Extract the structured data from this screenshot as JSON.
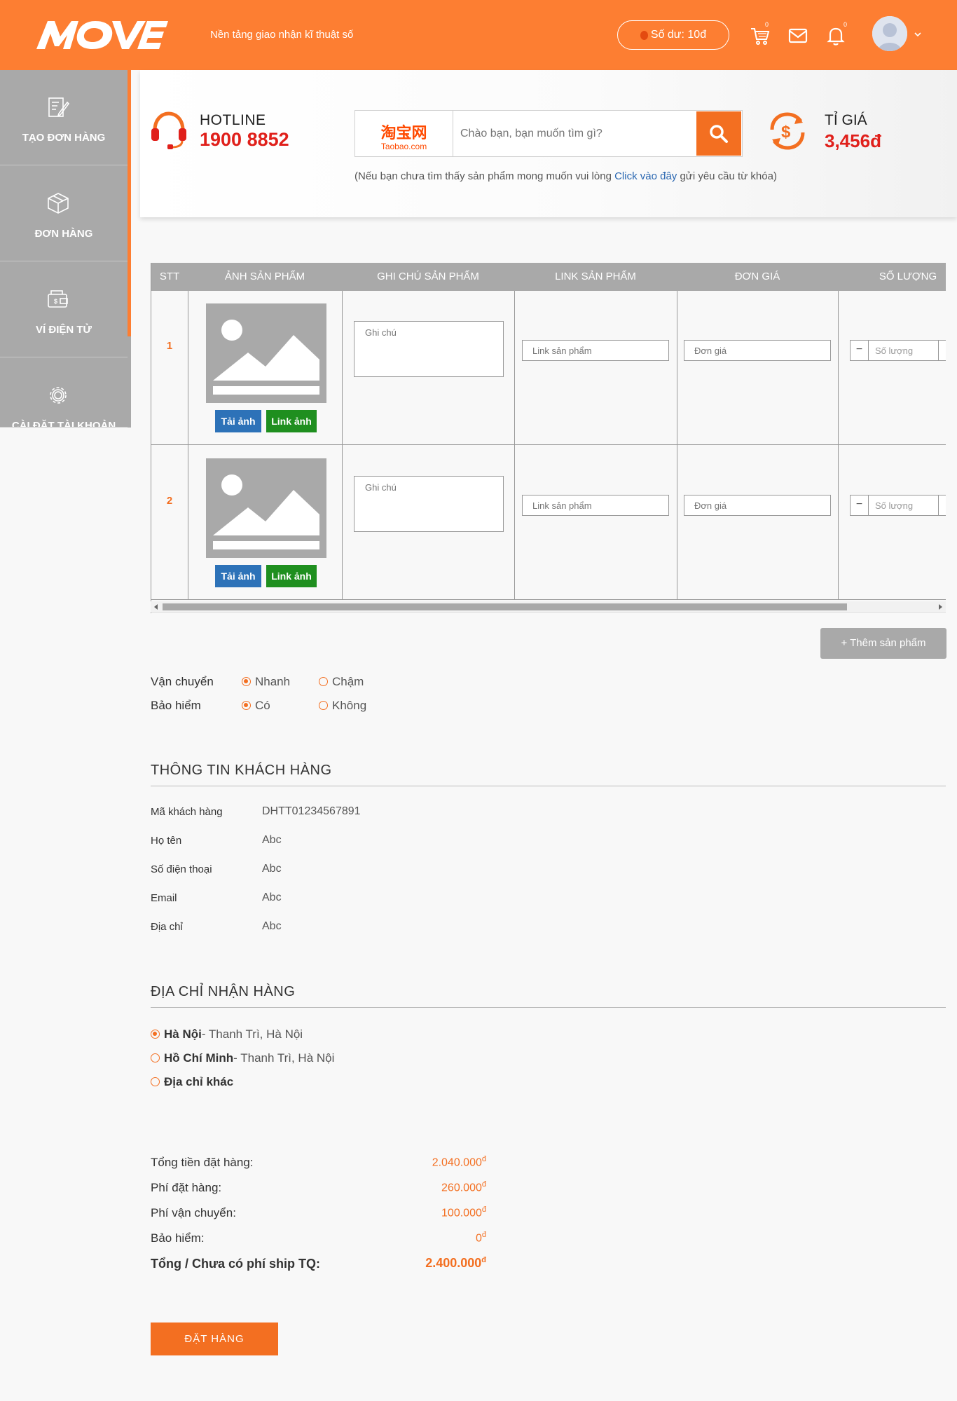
{
  "header": {
    "logo": "MOVE",
    "tagline": "Nền tảng giao nhận kĩ thuật số",
    "balance_label": "Số dư: 10đ",
    "cart_count": "0",
    "notif_count": "0",
    "icons": [
      "cart-icon",
      "mail-icon",
      "bell-icon",
      "avatar",
      "chevron-down-icon"
    ]
  },
  "sidebar": {
    "items": [
      {
        "label": "TẠO ĐƠN HÀNG",
        "icon": "edit-document-icon"
      },
      {
        "label": "ĐƠN HÀNG",
        "icon": "box-icon"
      },
      {
        "label": "VÍ ĐIỆN TỬ",
        "icon": "wallet-icon"
      },
      {
        "label": "CÀI ĐẶT TÀI KHOẢN",
        "icon": "gear-icon"
      }
    ]
  },
  "hotline": {
    "title": "HOTLINE",
    "number": "1900 8852"
  },
  "search": {
    "site_name": "淘宝网",
    "site_domain": "Taobao.com",
    "placeholder": "Chào bạn, bạn muốn tìm gì?",
    "hint_before": "(Nếu bạn chưa tìm thấy sản phẩm mong muốn vui lòng ",
    "hint_link": "Click vào đây",
    "hint_after": " gửi yêu cầu từ khóa)"
  },
  "rate": {
    "title": "TỈ GIÁ",
    "value": "3,456đ"
  },
  "table": {
    "columns": [
      "STT",
      "ẢNH SẢN PHẨM",
      "GHI CHÚ SẢN PHẨM",
      "LINK SẢN PHẨM",
      "ĐƠN GIÁ",
      "SỐ LƯỢNG"
    ],
    "rows": [
      {
        "stt": "1",
        "upload_label": "Tải ảnh",
        "link_label": "Link ảnh",
        "note_placeholder": "Ghi chú",
        "link_placeholder": "Link sản phẩm",
        "price_placeholder": "Đơn giá",
        "qty_placeholder": "Số lượng",
        "qty_minus": "−"
      },
      {
        "stt": "2",
        "upload_label": "Tải ảnh",
        "link_label": "Link ảnh",
        "note_placeholder": "Ghi chú",
        "link_placeholder": "Link sản phẩm",
        "price_placeholder": "Đơn giá",
        "qty_placeholder": "Số lượng",
        "qty_minus": "−"
      }
    ]
  },
  "add_product_label": "+ Thêm sản phẩm",
  "options": {
    "shipping": {
      "label": "Vận chuyển",
      "choices": [
        "Nhanh",
        "Chậm"
      ],
      "selected": "Nhanh"
    },
    "insurance": {
      "label": "Bảo hiểm",
      "choices": [
        "Có",
        "Không"
      ],
      "selected": "Có"
    }
  },
  "customer": {
    "title": "THÔNG TIN KHÁCH HÀNG",
    "fields": [
      {
        "key": "Mã khách hàng",
        "value": "DHTT01234567891"
      },
      {
        "key": "Họ tên",
        "value": "Abc"
      },
      {
        "key": "Số điện thoại",
        "value": "Abc"
      },
      {
        "key": "Email",
        "value": "Abc"
      },
      {
        "key": "Địa chỉ",
        "value": "Abc"
      }
    ]
  },
  "delivery": {
    "title": "ĐỊA CHỈ NHẬN HÀNG",
    "addresses": [
      {
        "city": "Hà Nội",
        "detail": "- Thanh Trì, Hà Nội",
        "selected": true
      },
      {
        "city": "Hồ Chí Minh",
        "detail": "- Thanh Trì, Hà Nội",
        "selected": false
      },
      {
        "city": "Địa chỉ khác",
        "detail": "",
        "selected": false
      }
    ]
  },
  "summary": {
    "rows": [
      {
        "key": "Tổng tiền đặt hàng:",
        "value": "2.040.000"
      },
      {
        "key": "Phí đặt hàng:",
        "value": "260.000"
      },
      {
        "key": "Phí vận chuyển:",
        "value": "100.000"
      },
      {
        "key": "Bảo hiểm:",
        "value": "0"
      }
    ],
    "total_key": "Tổng / Chưa có phí ship TQ:",
    "total_value": "2.400.000",
    "currency": "đ"
  },
  "order_button": "ĐẶT HÀNG",
  "colors": {
    "primary": "#fd7e32",
    "accent": "#f36f21",
    "hotline": "#e0201b",
    "sidebar": "#a9a9a9",
    "upload": "#2d72b8",
    "link": "#1f8f1f"
  }
}
